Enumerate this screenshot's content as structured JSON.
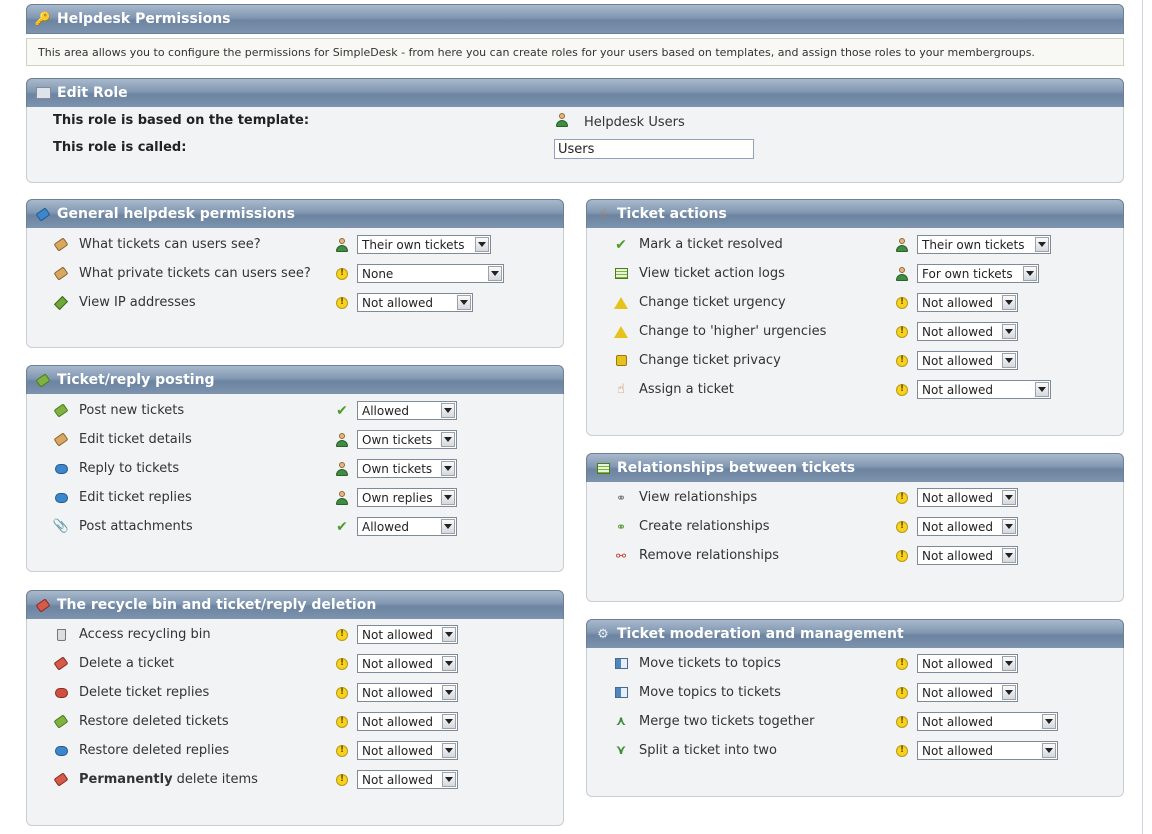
{
  "header": {
    "title": "Helpdesk Permissions",
    "description": "This area allows you to configure the permissions for SimpleDesk - from here you can create roles for your users based on templates, and assign those roles to your membergroups."
  },
  "edit_role": {
    "title": "Edit Role",
    "template_label": "This role is based on the template:",
    "template_value": "Helpdesk Users",
    "name_label": "This role is called:",
    "name_value": "Users"
  },
  "general": {
    "title": "General helpdesk permissions",
    "rows": [
      {
        "label": "What tickets can users see?",
        "status": "user",
        "value": "Their own tickets"
      },
      {
        "label": "What private tickets can users see?",
        "status": "warn",
        "value": "None"
      },
      {
        "label": "View IP addresses",
        "status": "warn",
        "value": "Not allowed"
      }
    ]
  },
  "posting": {
    "title": "Ticket/reply posting",
    "rows": [
      {
        "label": "Post new tickets",
        "status": "check",
        "value": "Allowed"
      },
      {
        "label": "Edit ticket details",
        "status": "user",
        "value": "Own tickets"
      },
      {
        "label": "Reply to tickets",
        "status": "user",
        "value": "Own tickets"
      },
      {
        "label": "Edit ticket replies",
        "status": "user",
        "value": "Own replies"
      },
      {
        "label": "Post attachments",
        "status": "check",
        "value": "Allowed"
      }
    ]
  },
  "recycle": {
    "title": "The recycle bin and ticket/reply deletion",
    "rows": [
      {
        "label": "Access recycling bin",
        "status": "warn",
        "value": "Not allowed"
      },
      {
        "label": "Delete a ticket",
        "status": "warn",
        "value": "Not allowed"
      },
      {
        "label": "Delete ticket replies",
        "status": "warn",
        "value": "Not allowed"
      },
      {
        "label": "Restore deleted tickets",
        "status": "warn",
        "value": "Not allowed"
      },
      {
        "label": "Restore deleted replies",
        "status": "warn",
        "value": "Not allowed"
      },
      {
        "label_bold": "Permanently",
        "label": " delete items",
        "status": "warn",
        "value": "Not allowed"
      }
    ]
  },
  "actions": {
    "title": "Ticket actions",
    "rows": [
      {
        "label": "Mark a ticket resolved",
        "status": "user",
        "value": "Their own tickets"
      },
      {
        "label": "View ticket action logs",
        "status": "user",
        "value": "For own tickets"
      },
      {
        "label": "Change ticket urgency",
        "status": "warn",
        "value": "Not allowed"
      },
      {
        "label": "Change to 'higher' urgencies",
        "status": "warn",
        "value": "Not allowed"
      },
      {
        "label": "Change ticket privacy",
        "status": "warn",
        "value": "Not allowed"
      },
      {
        "label": "Assign a ticket",
        "status": "warn",
        "value": "Not allowed"
      }
    ]
  },
  "relationships": {
    "title": "Relationships between tickets",
    "rows": [
      {
        "label": "View relationships",
        "status": "warn",
        "value": "Not allowed"
      },
      {
        "label": "Create relationships",
        "status": "warn",
        "value": "Not allowed"
      },
      {
        "label": "Remove relationships",
        "status": "warn",
        "value": "Not allowed"
      }
    ]
  },
  "moderation": {
    "title": "Ticket moderation and management",
    "rows": [
      {
        "label": "Move tickets to topics",
        "status": "warn",
        "value": "Not allowed"
      },
      {
        "label": "Move topics to tickets",
        "status": "warn",
        "value": "Not allowed"
      },
      {
        "label": "Merge two tickets together",
        "status": "warn",
        "value": "Not allowed"
      },
      {
        "label": "Split a ticket into two",
        "status": "warn",
        "value": "Not allowed"
      }
    ]
  },
  "colors": {
    "header": "#7d93ae",
    "panel": "#f2f3f4",
    "warn": "#f7d21e",
    "ok": "#4f9a2d"
  }
}
